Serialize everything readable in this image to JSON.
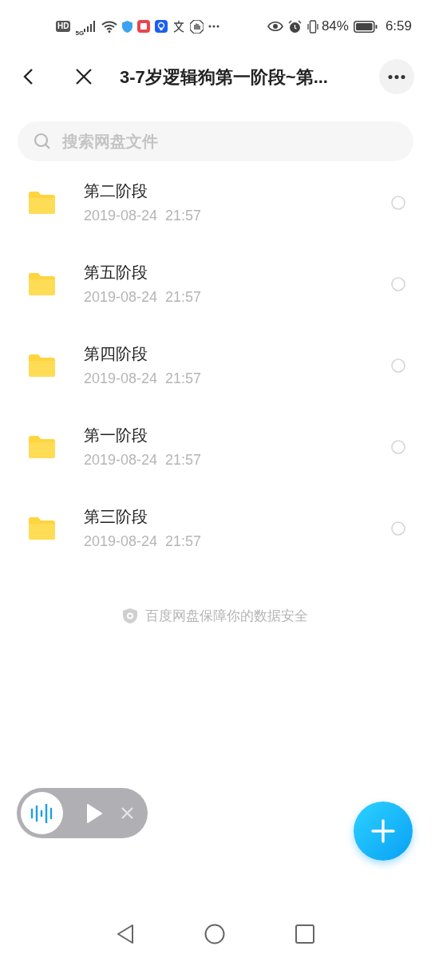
{
  "status_bar": {
    "hd": "HD",
    "network": "5G",
    "battery": "84%",
    "time": "6:59"
  },
  "header": {
    "title": "3-7岁逻辑狗第一阶段~第..."
  },
  "search": {
    "placeholder": "搜索网盘文件"
  },
  "files": [
    {
      "name": "第二阶段",
      "date": "2019-08-24  21:57",
      "selected": false
    },
    {
      "name": "第五阶段",
      "date": "2019-08-24  21:57",
      "selected": false
    },
    {
      "name": "第四阶段",
      "date": "2019-08-24  21:57",
      "selected": false
    },
    {
      "name": "第一阶段",
      "date": "2019-08-24  21:57",
      "selected": false
    },
    {
      "name": "第三阶段",
      "date": "2019-08-24  21:57",
      "selected": false
    }
  ],
  "footer_note": "百度网盘保障你的数据安全"
}
